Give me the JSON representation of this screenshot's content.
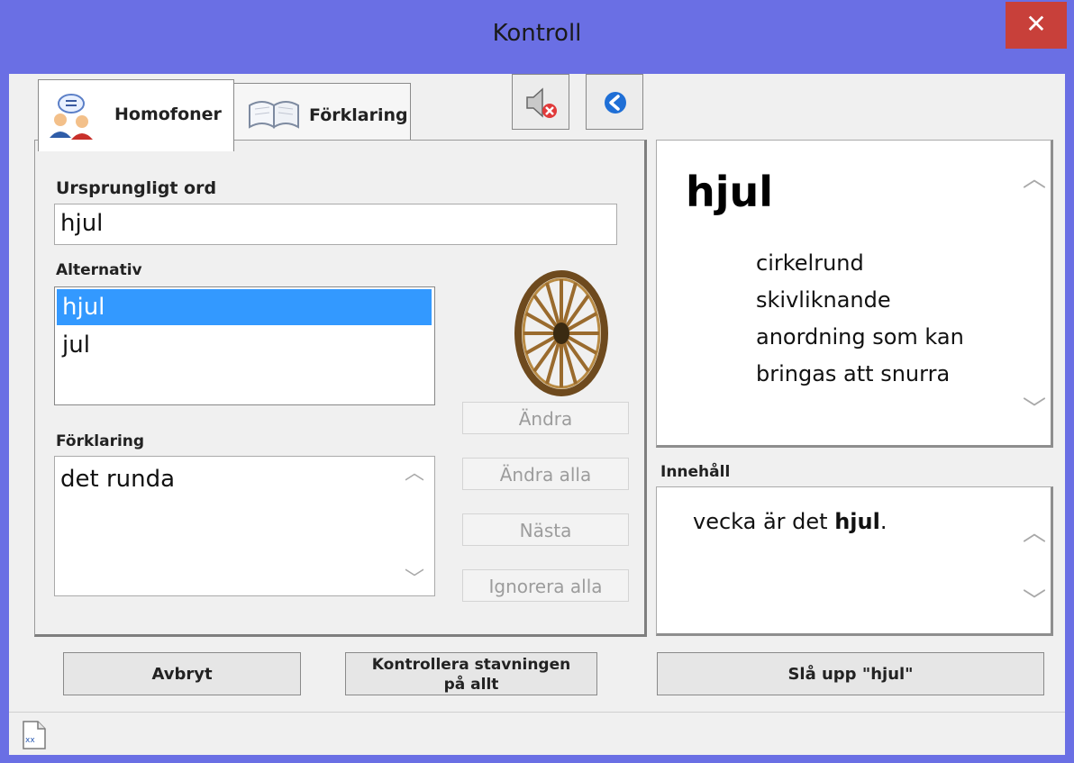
{
  "window": {
    "title": "Kontroll",
    "close_glyph": "✕"
  },
  "tabs": [
    {
      "label": "Homofoner",
      "icon": "people-speech-icon"
    },
    {
      "label": "Förklaring",
      "icon": "book-icon"
    }
  ],
  "toolbar": {
    "mute_icon": "speaker-muted-icon",
    "back_icon": "back-arrow-icon"
  },
  "original_word": {
    "label": "Ursprungligt ord",
    "value": "hjul"
  },
  "alternatives": {
    "label": "Alternativ",
    "items": [
      "hjul",
      "jul"
    ],
    "selected_index": 0
  },
  "explanation": {
    "label": "Förklaring",
    "value": "det runda"
  },
  "side_buttons": {
    "change": "Ändra",
    "change_all": "Ändra alla",
    "next": "Nästa",
    "ignore_all": "Ignorera alla"
  },
  "definition": {
    "word": "hjul",
    "text_lines": [
      "cirkelrund",
      "skivliknande",
      "anordning som kan",
      "bringas att snurra"
    ]
  },
  "context": {
    "label": "Innehåll",
    "prefix": "vecka är det ",
    "word": "hjul",
    "suffix": "."
  },
  "bottom_buttons": {
    "cancel": "Avbryt",
    "check_all": "Kontrollera stavningen på allt",
    "lookup": "Slå upp \"hjul\""
  },
  "status": {
    "file_icon": "document-icon",
    "file_icon_text": "xx"
  },
  "colors": {
    "titlebar": "#6a6fe4",
    "close": "#c8403a",
    "selection": "#3399ff"
  }
}
